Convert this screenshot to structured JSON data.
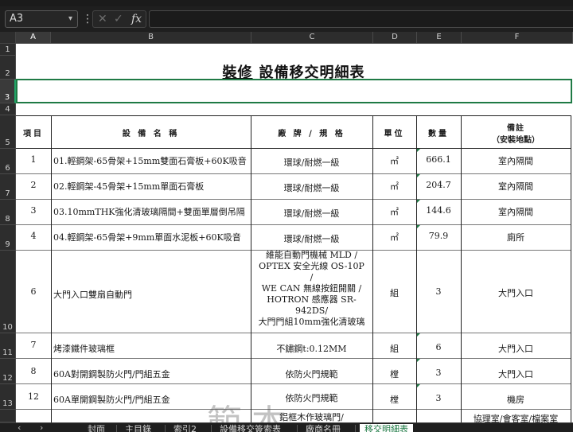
{
  "formula_bar": {
    "name_box": "A3",
    "name_box_chevron": "chevron-down-icon",
    "cancel_icon": "✕",
    "enter_icon": "✓",
    "function_icon": "fx",
    "formula": ""
  },
  "columns": [
    {
      "id": "A",
      "label": "A"
    },
    {
      "id": "B",
      "label": "B"
    },
    {
      "id": "C",
      "label": "C"
    },
    {
      "id": "D",
      "label": "D"
    },
    {
      "id": "E",
      "label": "E"
    },
    {
      "id": "F",
      "label": "F"
    }
  ],
  "rows": [
    "1",
    "2",
    "3",
    "4",
    "5",
    "6",
    "7",
    "8",
    "9",
    "10",
    "11",
    "12",
    "13"
  ],
  "sheet": {
    "title_prefix": "裝修",
    "title_main": "設備移交明細表",
    "headers": {
      "item": "項目",
      "name": "設 備 名 稱",
      "brand": "廠 牌 / 規 格",
      "unit": "單位",
      "qty": "數量",
      "remark_line1": "備註",
      "remark_line2": "（安裝地點）"
    },
    "items": [
      {
        "no": "1",
        "name": "01.輕鋼架-65骨架+15mm雙面石膏板+60K吸音",
        "brand": "環球/耐燃一級",
        "unit": "㎡",
        "qty": "666.1",
        "remark": "室內隔間"
      },
      {
        "no": "2",
        "name": "02.輕鋼架-45骨架+15mm單面石膏板",
        "brand": "環球/耐燃一級",
        "unit": "㎡",
        "qty": "204.7",
        "remark": "室內隔間"
      },
      {
        "no": "3",
        "name": "03.10mmTHK強化清玻璃隔間+雙面單層倒吊隔",
        "brand": "環球/耐燃一級",
        "unit": "㎡",
        "qty": "144.6",
        "remark": "室內隔間"
      },
      {
        "no": "4",
        "name": "04.輕鋼架-65骨架+9mm單面水泥板+60K吸音",
        "brand": "環球/耐燃一級",
        "unit": "㎡",
        "qty": "79.9",
        "remark": "廁所"
      },
      {
        "no": "6",
        "name": "大門入口雙扇自動門",
        "brand_lines": [
          "維能自動門機械 MLD /",
          "OPTEX 安全光線  OS-10P",
          "/",
          "WE CAN 無線按鈕開關 /",
          "HOTRON 感應器  SR-",
          "942DS/",
          "大門門組10mm強化清玻璃"
        ],
        "unit": "組",
        "qty": "3",
        "remark": "大門入口"
      },
      {
        "no": "7",
        "name": "烤漆鐵件玻璃框",
        "brand": "不鏽鋼t:0.12MM",
        "unit": "組",
        "qty": "6",
        "remark": "大門入口"
      },
      {
        "no": "8",
        "name": "60A對開鋼製防火門/門組五金",
        "brand": "依防火門規範",
        "unit": "樘",
        "qty": "3",
        "remark": "大門入口"
      },
      {
        "no": "12",
        "name": "60A單開鋼製防火門/門組五金",
        "brand": "依防火門規範",
        "unit": "樘",
        "qty": "3",
        "remark": "機房"
      },
      {
        "no": "13",
        "name": "",
        "brand": "鋁框木作玻璃門/",
        "unit": "",
        "qty": "",
        "remark": "協理室/會客室/檔案室"
      }
    ]
  },
  "tabs": {
    "nav_prev": "‹",
    "nav_next": "›",
    "items": [
      "封面",
      "主目錄",
      "索引2",
      "設備移交簽索表",
      "廠商名冊",
      "移交明細表"
    ],
    "active": "移交明細表"
  },
  "watermark": "範本"
}
